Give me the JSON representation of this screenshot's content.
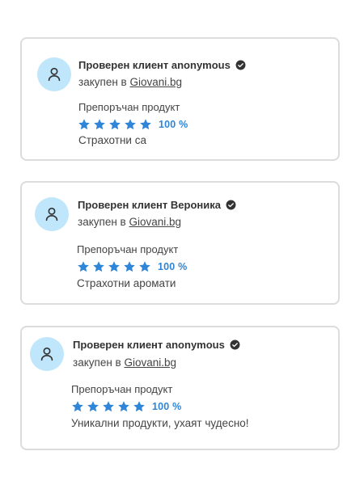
{
  "colors": {
    "accent": "#2f85d8",
    "avatar_bg": "#bfe6fb",
    "border": "#dcdcdc",
    "text": "#333333"
  },
  "icons": {
    "avatar": "user-icon",
    "verified": "verified-check-icon",
    "rating": "star-icon"
  },
  "reviews": [
    {
      "name": "Проверен клиент anonymous",
      "bought_prefix": "закупен в",
      "store_link": "Giovani.bg",
      "recommended": "Препоръчан продукт",
      "stars": 5,
      "percent": "100 %",
      "text": "Страхотни са"
    },
    {
      "name": "Проверен клиент Вероника",
      "bought_prefix": "закупен в",
      "store_link": "Giovani.bg",
      "recommended": "Препоръчан продукт",
      "stars": 5,
      "percent": "100 %",
      "text": "Страхотни аромати"
    },
    {
      "name": "Проверен клиент anonymous",
      "bought_prefix": "закупен в",
      "store_link": "Giovani.bg",
      "recommended": "Препоръчан продукт",
      "stars": 5,
      "percent": "100 %",
      "text": "Уникални продукти, ухаят чудесно!"
    }
  ]
}
